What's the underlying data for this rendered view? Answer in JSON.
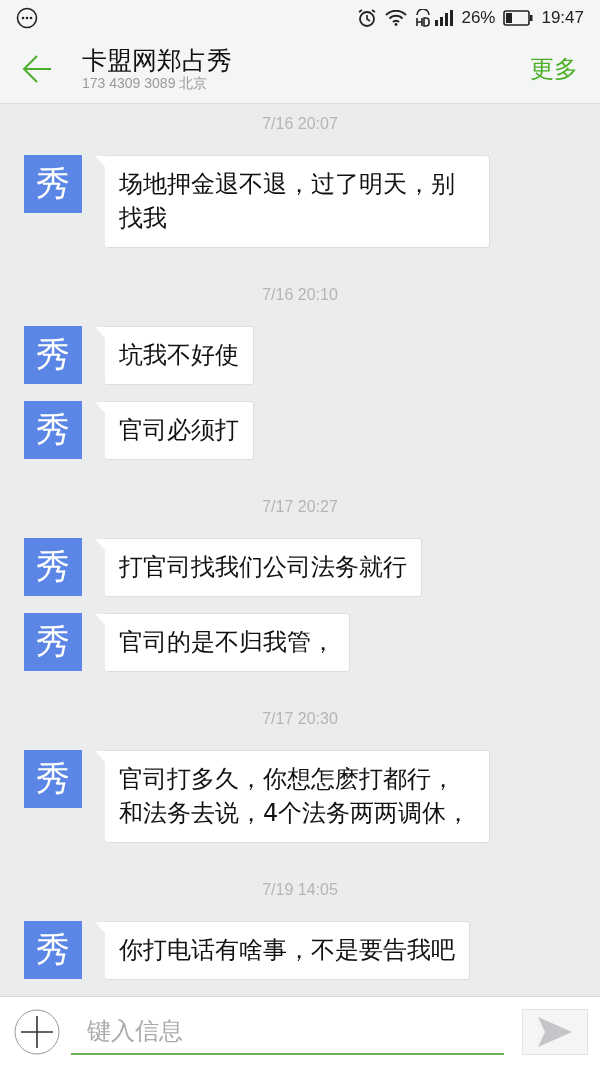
{
  "status_bar": {
    "battery_percent": "26%",
    "time": "19:47"
  },
  "header": {
    "title": "卡盟网郑占秀",
    "subtitle": "173 4309 3089 北京",
    "more": "更多"
  },
  "groups": [
    {
      "timestamp": "7/16 20:07",
      "messages": [
        {
          "avatar": "秀",
          "text": "场地押金退不退，过了明天，别找我"
        }
      ]
    },
    {
      "timestamp": "7/16 20:10",
      "messages": [
        {
          "avatar": "秀",
          "text": "坑我不好使"
        },
        {
          "avatar": "秀",
          "text": "官司必须打"
        }
      ]
    },
    {
      "timestamp": "7/17 20:27",
      "messages": [
        {
          "avatar": "秀",
          "text": "打官司找我们公司法务就行"
        },
        {
          "avatar": "秀",
          "text": "官司的是不归我管，"
        }
      ]
    },
    {
      "timestamp": "7/17 20:30",
      "messages": [
        {
          "avatar": "秀",
          "text": "官司打多久，你想怎麽打都行，和法务去说，4个法务两两调休，"
        }
      ]
    },
    {
      "timestamp": "7/19 14:05",
      "messages": [
        {
          "avatar": "秀",
          "text": "你打电话有啥事，不是要告我吧"
        }
      ]
    }
  ],
  "input": {
    "placeholder": "键入信息"
  }
}
